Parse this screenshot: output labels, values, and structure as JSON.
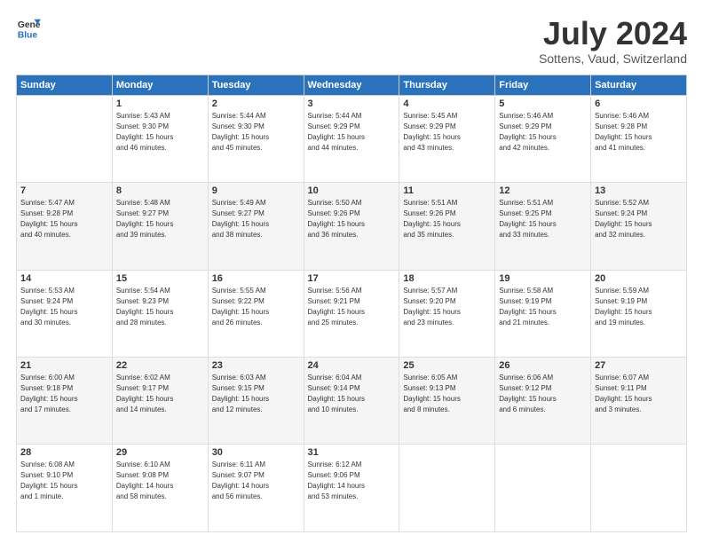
{
  "logo": {
    "line1": "General",
    "line2": "Blue"
  },
  "title": "July 2024",
  "location": "Sottens, Vaud, Switzerland",
  "weekdays": [
    "Sunday",
    "Monday",
    "Tuesday",
    "Wednesday",
    "Thursday",
    "Friday",
    "Saturday"
  ],
  "weeks": [
    [
      {
        "day": "",
        "info": ""
      },
      {
        "day": "1",
        "info": "Sunrise: 5:43 AM\nSunset: 9:30 PM\nDaylight: 15 hours\nand 46 minutes."
      },
      {
        "day": "2",
        "info": "Sunrise: 5:44 AM\nSunset: 9:30 PM\nDaylight: 15 hours\nand 45 minutes."
      },
      {
        "day": "3",
        "info": "Sunrise: 5:44 AM\nSunset: 9:29 PM\nDaylight: 15 hours\nand 44 minutes."
      },
      {
        "day": "4",
        "info": "Sunrise: 5:45 AM\nSunset: 9:29 PM\nDaylight: 15 hours\nand 43 minutes."
      },
      {
        "day": "5",
        "info": "Sunrise: 5:46 AM\nSunset: 9:29 PM\nDaylight: 15 hours\nand 42 minutes."
      },
      {
        "day": "6",
        "info": "Sunrise: 5:46 AM\nSunset: 9:28 PM\nDaylight: 15 hours\nand 41 minutes."
      }
    ],
    [
      {
        "day": "7",
        "info": "Sunrise: 5:47 AM\nSunset: 9:28 PM\nDaylight: 15 hours\nand 40 minutes."
      },
      {
        "day": "8",
        "info": "Sunrise: 5:48 AM\nSunset: 9:27 PM\nDaylight: 15 hours\nand 39 minutes."
      },
      {
        "day": "9",
        "info": "Sunrise: 5:49 AM\nSunset: 9:27 PM\nDaylight: 15 hours\nand 38 minutes."
      },
      {
        "day": "10",
        "info": "Sunrise: 5:50 AM\nSunset: 9:26 PM\nDaylight: 15 hours\nand 36 minutes."
      },
      {
        "day": "11",
        "info": "Sunrise: 5:51 AM\nSunset: 9:26 PM\nDaylight: 15 hours\nand 35 minutes."
      },
      {
        "day": "12",
        "info": "Sunrise: 5:51 AM\nSunset: 9:25 PM\nDaylight: 15 hours\nand 33 minutes."
      },
      {
        "day": "13",
        "info": "Sunrise: 5:52 AM\nSunset: 9:24 PM\nDaylight: 15 hours\nand 32 minutes."
      }
    ],
    [
      {
        "day": "14",
        "info": "Sunrise: 5:53 AM\nSunset: 9:24 PM\nDaylight: 15 hours\nand 30 minutes."
      },
      {
        "day": "15",
        "info": "Sunrise: 5:54 AM\nSunset: 9:23 PM\nDaylight: 15 hours\nand 28 minutes."
      },
      {
        "day": "16",
        "info": "Sunrise: 5:55 AM\nSunset: 9:22 PM\nDaylight: 15 hours\nand 26 minutes."
      },
      {
        "day": "17",
        "info": "Sunrise: 5:56 AM\nSunset: 9:21 PM\nDaylight: 15 hours\nand 25 minutes."
      },
      {
        "day": "18",
        "info": "Sunrise: 5:57 AM\nSunset: 9:20 PM\nDaylight: 15 hours\nand 23 minutes."
      },
      {
        "day": "19",
        "info": "Sunrise: 5:58 AM\nSunset: 9:19 PM\nDaylight: 15 hours\nand 21 minutes."
      },
      {
        "day": "20",
        "info": "Sunrise: 5:59 AM\nSunset: 9:19 PM\nDaylight: 15 hours\nand 19 minutes."
      }
    ],
    [
      {
        "day": "21",
        "info": "Sunrise: 6:00 AM\nSunset: 9:18 PM\nDaylight: 15 hours\nand 17 minutes."
      },
      {
        "day": "22",
        "info": "Sunrise: 6:02 AM\nSunset: 9:17 PM\nDaylight: 15 hours\nand 14 minutes."
      },
      {
        "day": "23",
        "info": "Sunrise: 6:03 AM\nSunset: 9:15 PM\nDaylight: 15 hours\nand 12 minutes."
      },
      {
        "day": "24",
        "info": "Sunrise: 6:04 AM\nSunset: 9:14 PM\nDaylight: 15 hours\nand 10 minutes."
      },
      {
        "day": "25",
        "info": "Sunrise: 6:05 AM\nSunset: 9:13 PM\nDaylight: 15 hours\nand 8 minutes."
      },
      {
        "day": "26",
        "info": "Sunrise: 6:06 AM\nSunset: 9:12 PM\nDaylight: 15 hours\nand 6 minutes."
      },
      {
        "day": "27",
        "info": "Sunrise: 6:07 AM\nSunset: 9:11 PM\nDaylight: 15 hours\nand 3 minutes."
      }
    ],
    [
      {
        "day": "28",
        "info": "Sunrise: 6:08 AM\nSunset: 9:10 PM\nDaylight: 15 hours\nand 1 minute."
      },
      {
        "day": "29",
        "info": "Sunrise: 6:10 AM\nSunset: 9:08 PM\nDaylight: 14 hours\nand 58 minutes."
      },
      {
        "day": "30",
        "info": "Sunrise: 6:11 AM\nSunset: 9:07 PM\nDaylight: 14 hours\nand 56 minutes."
      },
      {
        "day": "31",
        "info": "Sunrise: 6:12 AM\nSunset: 9:06 PM\nDaylight: 14 hours\nand 53 minutes."
      },
      {
        "day": "",
        "info": ""
      },
      {
        "day": "",
        "info": ""
      },
      {
        "day": "",
        "info": ""
      }
    ]
  ]
}
